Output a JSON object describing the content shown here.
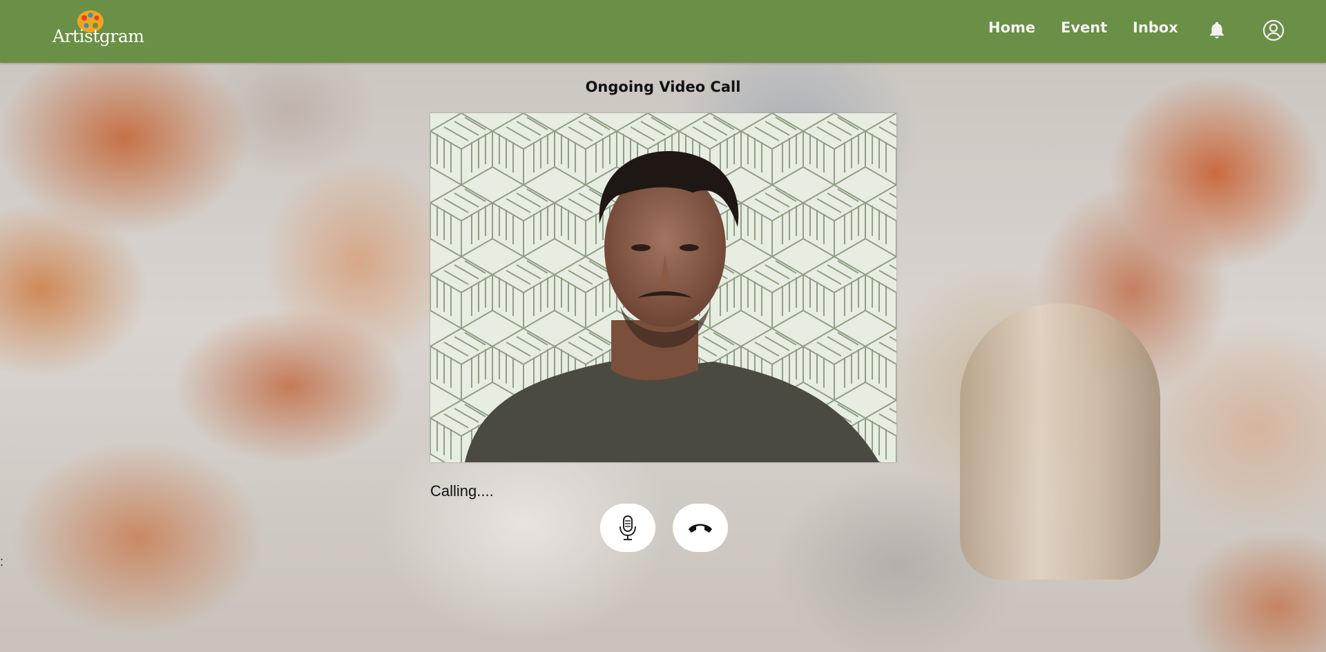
{
  "app": {
    "logo_text": "Artistgram"
  },
  "nav": {
    "home": "Home",
    "event": "Event",
    "inbox": "Inbox",
    "icons": [
      "bell-icon",
      "user-circle-icon"
    ]
  },
  "call": {
    "title": "Ongoing Video Call",
    "status": "Calling....",
    "controls": [
      "microphone-icon",
      "end-call-icon"
    ]
  },
  "colors": {
    "header_bg": "#6a8f46",
    "nav_text": "#f2f2f2",
    "button_bg": "#ffffff"
  },
  "misc": {
    "stray_text": ":"
  }
}
